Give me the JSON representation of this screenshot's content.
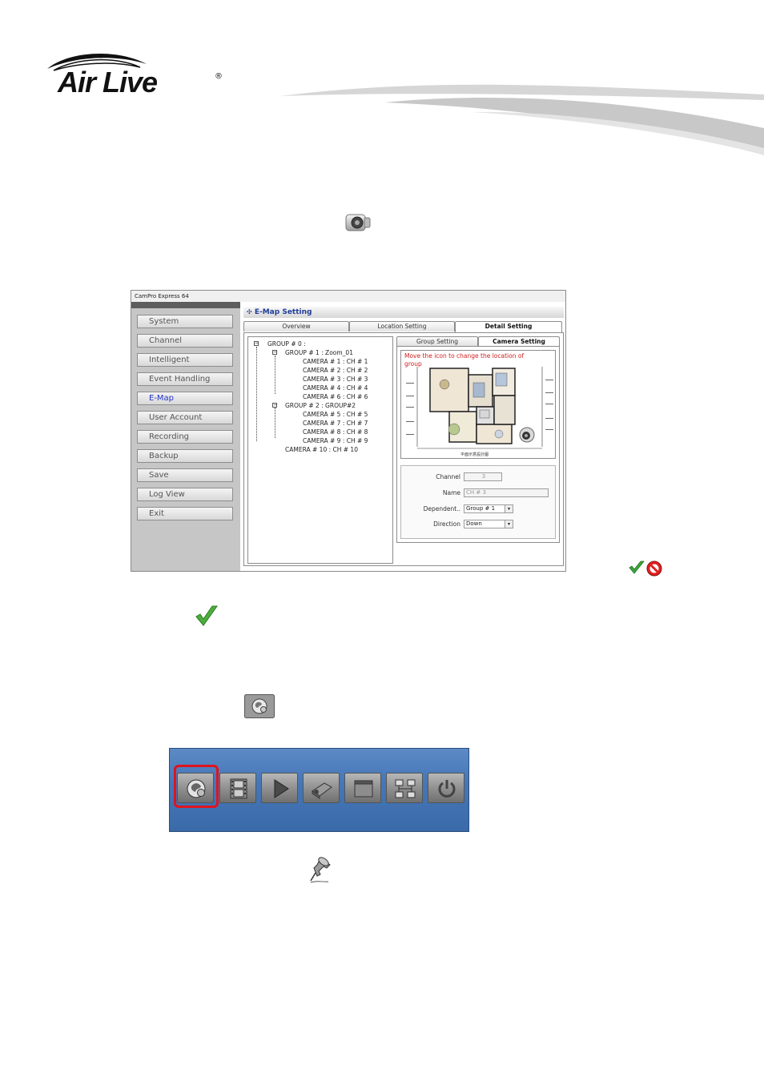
{
  "brand": {
    "logo_text": "Air Live",
    "registered": "®"
  },
  "window": {
    "title": "CamPro Express 64",
    "sidebar": [
      "System",
      "Channel",
      "Intelligent",
      "Event Handling",
      "E-Map",
      "User Account",
      "Recording",
      "Backup",
      "Save",
      "Log View",
      "Exit"
    ],
    "active_item": "E-Map",
    "section_title": "E-Map Setting",
    "tabs": [
      "Overview",
      "Location Setting",
      "Detail Setting"
    ],
    "active_tab": "Detail Setting",
    "tree": [
      "GROUP # 0 :",
      "GROUP # 1 : Zoom_01",
      "CAMERA # 1 : CH # 1",
      "CAMERA # 2 : CH # 2",
      "CAMERA # 3 : CH # 3",
      "CAMERA # 4 : CH # 4",
      "CAMERA # 6 : CH # 6",
      "GROUP # 2 : GROUP#2",
      "CAMERA # 5 : CH # 5",
      "CAMERA # 7 : CH # 7",
      "CAMERA # 8 : CH # 8",
      "CAMERA # 9 : CH # 9",
      "CAMERA # 10 : CH # 10"
    ],
    "sub_tabs": [
      "Group Setting",
      "Camera Setting"
    ],
    "active_sub_tab": "Camera Setting",
    "map_message": "Move the icon to change the location of group",
    "map_caption": "平面示意設計圖",
    "form": {
      "channel_label": "Channel",
      "channel_value": "3",
      "name_label": "Name",
      "name_value": "CH # 3",
      "dependent_label": "Dependent..",
      "dependent_value": "Group # 1",
      "direction_label": "Direction",
      "direction_value": "Down"
    }
  },
  "toolbar": {
    "buttons": [
      "emap-icon",
      "film-icon",
      "play-icon",
      "camera-icon",
      "window-icon",
      "network-icon",
      "power-icon"
    ],
    "highlighted": "emap-icon"
  },
  "colors": {
    "accent_blue": "#1f3d99",
    "toolbar_blue": "#4677b8",
    "highlight_red": "#e0141e",
    "check_green": "#3aa83a"
  }
}
